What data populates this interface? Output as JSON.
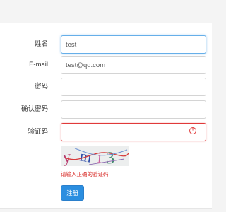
{
  "form": {
    "name": {
      "label": "姓名",
      "value": "test"
    },
    "email": {
      "label": "E-mail",
      "value": "test@qq.com"
    },
    "password": {
      "label": "密码",
      "value": ""
    },
    "confirm_password": {
      "label": "确认密码",
      "value": ""
    },
    "captcha": {
      "label": "验证码",
      "value": "",
      "state_icon": "exclamation-circle-icon",
      "image_text": "ymi3",
      "error_message": "请输入正确的验证码"
    },
    "submit_label": "注册"
  },
  "colors": {
    "primary_button": "#2b8ee0",
    "error": "#e03a3a",
    "focus": "#66afe9"
  }
}
